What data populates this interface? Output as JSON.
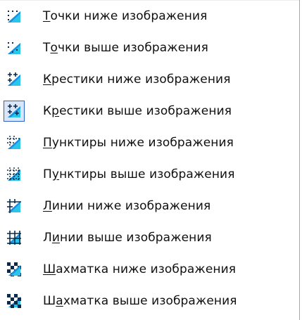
{
  "menu": {
    "items": [
      {
        "before": "",
        "mnemonic": "Т",
        "after": "очки ниже изображения",
        "icon": "points-below-icon",
        "selected": false
      },
      {
        "before": "Т",
        "mnemonic": "о",
        "after": "чки выше изображения",
        "icon": "points-above-icon",
        "selected": false
      },
      {
        "before": "",
        "mnemonic": "К",
        "after": "рестики ниже изображения",
        "icon": "crosses-below-icon",
        "selected": false
      },
      {
        "before": "К",
        "mnemonic": "р",
        "after": "естики выше изображения",
        "icon": "crosses-above-icon",
        "selected": true
      },
      {
        "before": "",
        "mnemonic": "П",
        "after": "унктиры ниже изображения",
        "icon": "dashes-below-icon",
        "selected": false
      },
      {
        "before": "П",
        "mnemonic": "у",
        "after": "нктиры выше изображения",
        "icon": "dashes-above-icon",
        "selected": false
      },
      {
        "before": "",
        "mnemonic": "Л",
        "after": "инии ниже изображения",
        "icon": "lines-below-icon",
        "selected": false
      },
      {
        "before": "Л",
        "mnemonic": "и",
        "after": "нии выше изображения",
        "icon": "lines-above-icon",
        "selected": false
      },
      {
        "before": "",
        "mnemonic": "Ш",
        "after": "ахматка ниже изображения",
        "icon": "checkerboard-below-icon",
        "selected": false
      },
      {
        "before": "Ш",
        "mnemonic": "а",
        "after": "хматка выше изображения",
        "icon": "checkerboard-above-icon",
        "selected": false
      }
    ]
  },
  "colors": {
    "icon_blue": "#1a5bd6",
    "icon_cyan": "#29c5ea",
    "icon_dark": "#0a2a4a",
    "selected_border": "#2b63c7",
    "selected_bg": "#d9e6fa"
  }
}
